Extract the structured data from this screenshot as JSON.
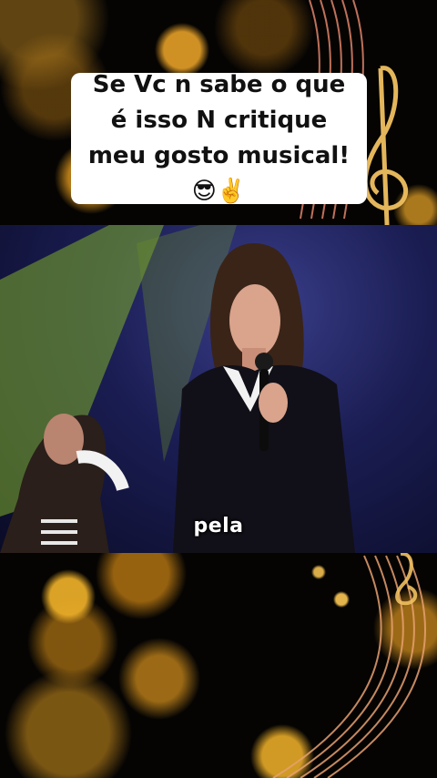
{
  "caption": {
    "text": "Se Vc n sabe o que é isso N critique meu gosto musical! 😎✌️"
  },
  "video": {
    "subtitle": "pela"
  },
  "colors": {
    "caption_bg": "#ffffff",
    "caption_text": "#111111",
    "bokeh_gold": "#e6a028",
    "staff_lines": "#e0846a",
    "video_bg": "#1a1d52"
  },
  "icons": [
    "treble-clef-icon",
    "music-staff-icon",
    "microphone-icon"
  ]
}
